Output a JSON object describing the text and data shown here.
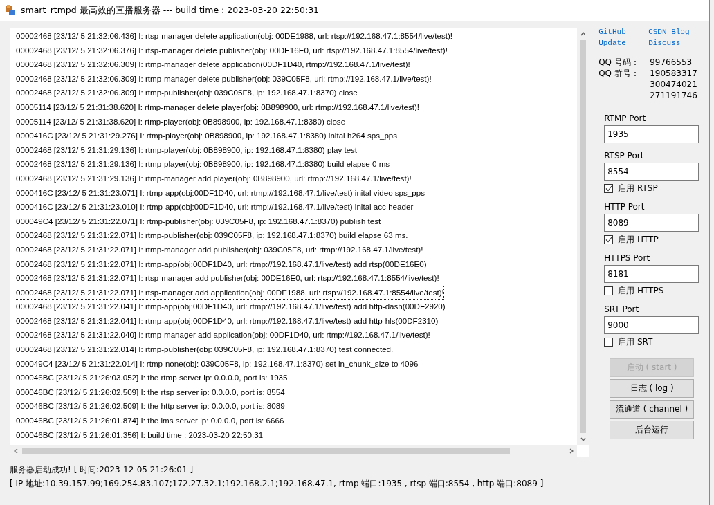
{
  "window": {
    "title": "smart_rtmpd 最高效的直播服务器 --- build time : 2023-03-20 22:50:31"
  },
  "log": [
    {
      "text": "00002468 [23/12/ 5 21:32:06.436] I: rtsp-manager delete application(obj: 00DE1988, url: rtsp://192.168.47.1:8554/live/test)!",
      "selected": false
    },
    {
      "text": "00002468 [23/12/ 5 21:32:06.376] I: rtsp-manager delete publisher(obj: 00DE16E0, url: rtsp://192.168.47.1:8554/live/test)!",
      "selected": false
    },
    {
      "text": "00002468 [23/12/ 5 21:32:06.309] I: rtmp-manager delete application(00DF1D40, rtmp://192.168.47.1/live/test)!",
      "selected": false
    },
    {
      "text": "00002468 [23/12/ 5 21:32:06.309] I: rtmp-manager delete publisher(obj: 039C05F8, url: rtmp://192.168.47.1/live/test)!",
      "selected": false
    },
    {
      "text": "00002468 [23/12/ 5 21:32:06.309] I: rtmp-publisher(obj: 039C05F8, ip: 192.168.47.1:8370) close",
      "selected": false
    },
    {
      "text": "00005114 [23/12/ 5 21:31:38.620] I: rtmp-manager delete player(obj: 0B898900, url: rtmp://192.168.47.1/live/test)!",
      "selected": false
    },
    {
      "text": "00005114 [23/12/ 5 21:31:38.620] I: rtmp-player(obj: 0B898900, ip: 192.168.47.1:8380) close",
      "selected": false
    },
    {
      "text": "0000416C [23/12/ 5 21:31:29.276] I: rtmp-player(obj: 0B898900, ip: 192.168.47.1:8380) inital h264 sps_pps",
      "selected": false
    },
    {
      "text": "00002468 [23/12/ 5 21:31:29.136] I: rtmp-player(obj: 0B898900, ip: 192.168.47.1:8380) play test",
      "selected": false
    },
    {
      "text": "00002468 [23/12/ 5 21:31:29.136] I: rtmp-player(obj: 0B898900, ip: 192.168.47.1:8380) build elapse 0 ms",
      "selected": false
    },
    {
      "text": "00002468 [23/12/ 5 21:31:29.136] I: rtmp-manager add player(obj: 0B898900, url: rtmp://192.168.47.1/live/test)!",
      "selected": false
    },
    {
      "text": "0000416C [23/12/ 5 21:31:23.071] I: rtmp-app(obj:00DF1D40, url: rtmp://192.168.47.1/live/test) inital video sps_pps",
      "selected": false
    },
    {
      "text": "0000416C [23/12/ 5 21:31:23.010] I: rtmp-app(obj:00DF1D40, url: rtmp://192.168.47.1/live/test) inital acc header",
      "selected": false
    },
    {
      "text": "000049C4 [23/12/ 5 21:31:22.071] I: rtmp-publisher(obj: 039C05F8, ip: 192.168.47.1:8370) publish test",
      "selected": false
    },
    {
      "text": "00002468 [23/12/ 5 21:31:22.071] I: rtmp-publisher(obj: 039C05F8, ip: 192.168.47.1:8370) build elapse 63 ms.",
      "selected": false
    },
    {
      "text": "00002468 [23/12/ 5 21:31:22.071] I: rtmp-manager add publisher(obj: 039C05F8, url: rtmp://192.168.47.1/live/test)!",
      "selected": false
    },
    {
      "text": "00002468 [23/12/ 5 21:31:22.071] I: rtmp-app(obj:00DF1D40, url: rtmp://192.168.47.1/live/test) add rtsp(00DE16E0)",
      "selected": false
    },
    {
      "text": "00002468 [23/12/ 5 21:31:22.071] I: rtsp-manager add publisher(obj: 00DE16E0, url: rtsp://192.168.47.1:8554/live/test)!",
      "selected": false
    },
    {
      "text": "00002468 [23/12/ 5 21:31:22.071] I: rtsp-manager add application(obj: 00DE1988, url: rtsp://192.168.47.1:8554/live/test)!",
      "selected": true
    },
    {
      "text": "00002468 [23/12/ 5 21:31:22.041] I: rtmp-app(obj:00DF1D40, url: rtmp://192.168.47.1/live/test) add http-dash(00DF2920)",
      "selected": false
    },
    {
      "text": "00002468 [23/12/ 5 21:31:22.041] I: rtmp-app(obj:00DF1D40, url: rtmp://192.168.47.1/live/test) add http-hls(00DF2310)",
      "selected": false
    },
    {
      "text": "00002468 [23/12/ 5 21:31:22.040] I: rtmp-manager add application(obj: 00DF1D40, url: rtmp://192.168.47.1/live/test)!",
      "selected": false
    },
    {
      "text": "00002468 [23/12/ 5 21:31:22.014] I: rtmp-publisher(obj: 039C05F8, ip: 192.168.47.1:8370) test connected.",
      "selected": false
    },
    {
      "text": "000049C4 [23/12/ 5 21:31:22.014] I: rtmp-none(obj: 039C05F8, ip: 192.168.47.1:8370) set in_chunk_size to 4096",
      "selected": false
    },
    {
      "text": "000046BC [23/12/ 5 21:26:03.052] I: the rtmp server ip: 0.0.0.0, port is: 1935",
      "selected": false
    },
    {
      "text": "000046BC [23/12/ 5 21:26:02.509] I: the rtsp server ip: 0.0.0.0, port is: 8554",
      "selected": false
    },
    {
      "text": "000046BC [23/12/ 5 21:26:02.509] I: the http server ip: 0.0.0.0, port is: 8089",
      "selected": false
    },
    {
      "text": "000046BC [23/12/ 5 21:26:01.874] I: the ims server ip: 0.0.0.0, port is: 6666",
      "selected": false
    },
    {
      "text": "000046BC [23/12/ 5 21:26:01.356] I: build time : 2023-03-20 22:50:31",
      "selected": false
    }
  ],
  "links": [
    "GitHub",
    "CSDN Blog",
    "Update",
    "Discuss"
  ],
  "qq": [
    {
      "label": "QQ 号码：",
      "values": [
        "99766553"
      ]
    },
    {
      "label": "QQ 群号：",
      "values": [
        "190583317",
        "300474021",
        "271191746"
      ]
    }
  ],
  "ports": [
    {
      "label": "RTMP Port",
      "value": "1935"
    },
    {
      "label": "RTSP Port",
      "value": "8554",
      "enable": {
        "label": "启用 RTSP",
        "checked": true
      }
    },
    {
      "label": "HTTP Port",
      "value": "8089",
      "enable": {
        "label": "启用 HTTP",
        "checked": true
      }
    },
    {
      "label": "HTTPS Port",
      "value": "8181",
      "enable": {
        "label": "启用 HTTPS",
        "checked": false
      }
    },
    {
      "label": "SRT Port",
      "value": "9000",
      "enable": {
        "label": "启用 SRT",
        "checked": false
      }
    }
  ],
  "buttons": [
    {
      "label": "启动 ( start )",
      "disabled": true
    },
    {
      "label": "日志 ( log )",
      "disabled": false
    },
    {
      "label": "流通道 ( channel )",
      "disabled": false
    },
    {
      "label": "后台运行",
      "disabled": false
    }
  ],
  "status": [
    "服务器启动成功! [ 时间:2023-12-05 21:26:01 ]",
    "[ IP 地址:10.39.157.99;169.254.83.107;172.27.32.1;192.168.2.1;192.168.47.1,  rtmp 端口:1935 ,  rtsp 端口:8554 ,  http 端口:8089 ]"
  ]
}
